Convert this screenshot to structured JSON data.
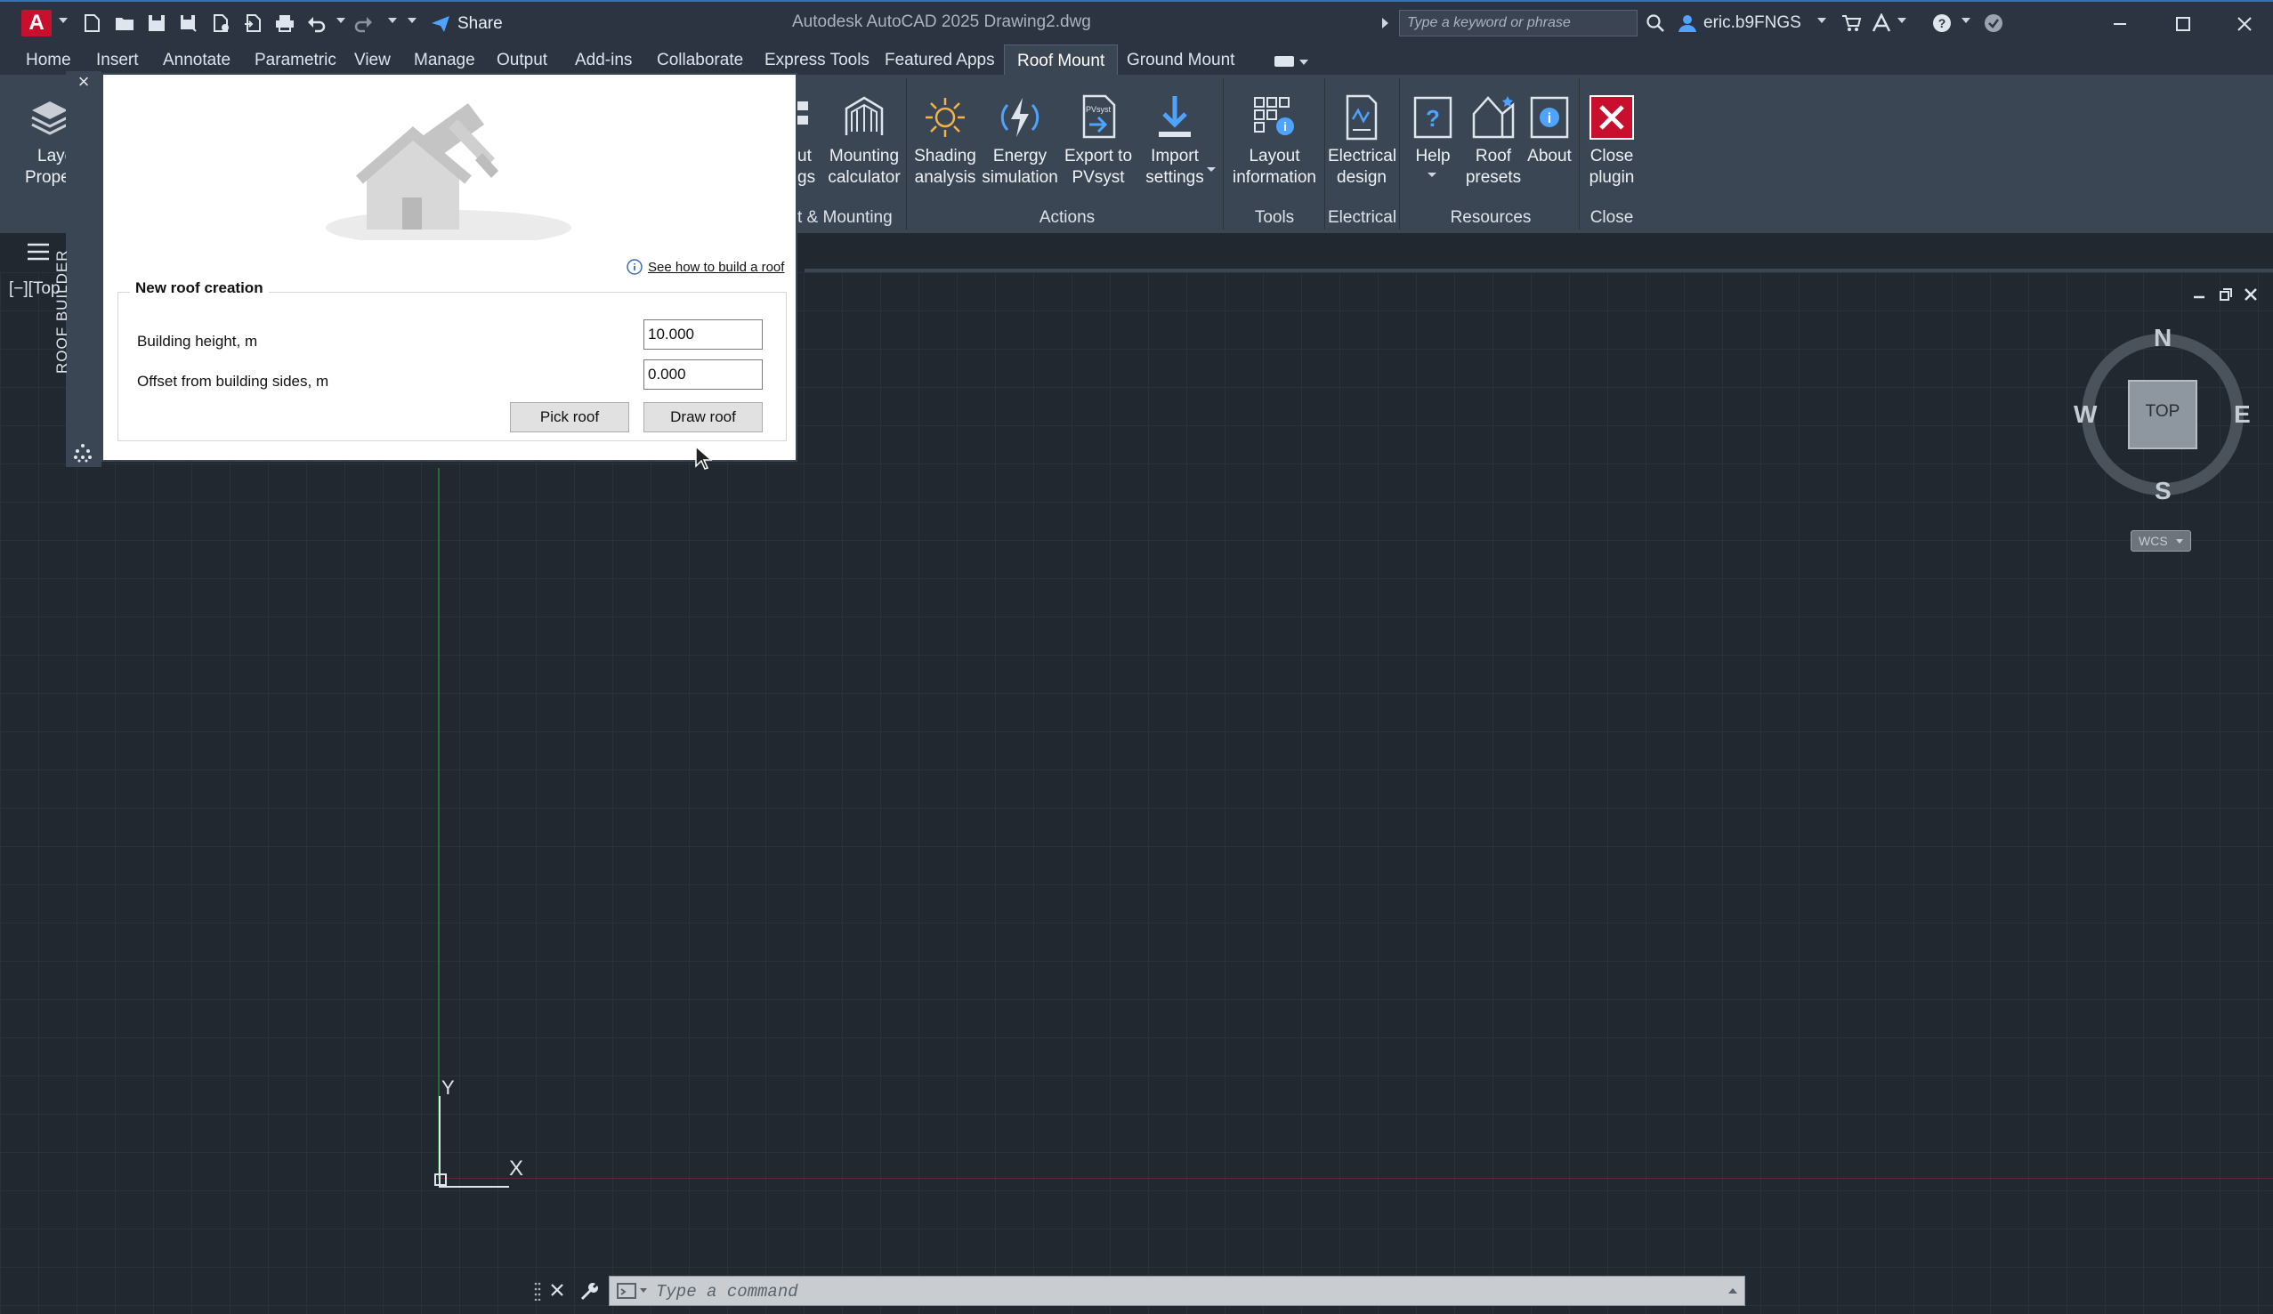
{
  "titlebar": {
    "logo_letter": "A",
    "share_label": "Share",
    "window_title": "Autodesk AutoCAD 2025    Drawing2.dwg",
    "search_placeholder": "Type a keyword or phrase",
    "user_name": "eric.b9FNGS"
  },
  "menu_tabs": [
    {
      "label": "Home"
    },
    {
      "label": "Insert"
    },
    {
      "label": "Annotate"
    },
    {
      "label": "Parametric"
    },
    {
      "label": "View"
    },
    {
      "label": "Manage"
    },
    {
      "label": "Output"
    },
    {
      "label": "Add-ins"
    },
    {
      "label": "Collaborate"
    },
    {
      "label": "Express Tools"
    },
    {
      "label": "Featured Apps"
    },
    {
      "label": "Roof Mount"
    },
    {
      "label": "Ground Mount"
    }
  ],
  "active_tab": "Roof Mount",
  "ribbon": {
    "left_button": {
      "line1": "Laye",
      "line2": "Proper"
    },
    "partial_button": {
      "line1": "ut",
      "line2": "gs"
    },
    "buttons": [
      {
        "line1": "Mounting",
        "line2": "calculator",
        "icon": "mounting-calculator-icon"
      },
      {
        "line1": "Shading",
        "line2": "analysis",
        "icon": "sun-icon"
      },
      {
        "line1": "Energy",
        "line2": "simulation",
        "icon": "lightning-icon"
      },
      {
        "line1": "Export to",
        "line2": "PVsyst",
        "icon": "pvsyst-export-icon"
      },
      {
        "line1": "Import",
        "line2": "settings",
        "icon": "import-download-icon"
      },
      {
        "line1": "Layout",
        "line2": "information",
        "icon": "layout-info-icon"
      },
      {
        "line1": "Electrical",
        "line2": "design",
        "icon": "electrical-design-icon"
      },
      {
        "line1": "Help",
        "line2": "",
        "icon": "help-icon"
      },
      {
        "line1": "Roof",
        "line2": "presets",
        "icon": "roof-presets-icon"
      },
      {
        "line1": "About",
        "line2": "",
        "icon": "about-icon"
      },
      {
        "line1": "Close",
        "line2": "plugin",
        "icon": "close-plugin-icon"
      }
    ],
    "panels": [
      {
        "label": "t & Mounting"
      },
      {
        "label": "Actions"
      },
      {
        "label": "Tools"
      },
      {
        "label": "Electrical"
      },
      {
        "label": "Resources"
      },
      {
        "label": "Close"
      }
    ]
  },
  "viewport_label": "[−][Top",
  "palette": {
    "vertical_title": "ROOF BUILDER",
    "close_glyph": "×",
    "help_link": "See how to build a roof",
    "group_title": "New roof creation",
    "fields": [
      {
        "label": "Building height, m",
        "value": "10.000"
      },
      {
        "label": "Offset from building sides, m",
        "value": "0.000"
      }
    ],
    "pick_roof_label": "Pick roof",
    "draw_roof_label": "Draw roof"
  },
  "viewcube": {
    "north": "N",
    "south": "S",
    "east": "E",
    "west": "W",
    "face": "TOP",
    "wcs_label": "WCS"
  },
  "ucs": {
    "x_label": "X",
    "y_label": "Y"
  },
  "command_line": {
    "placeholder": "Type a command"
  },
  "colors": {
    "accent_blue": "#3b6fb5",
    "logo_red": "#c8102e",
    "close_plugin_red": "#c8102e",
    "x_axis_red": "#7a2a2a",
    "y_axis_green": "#2b6a34"
  }
}
